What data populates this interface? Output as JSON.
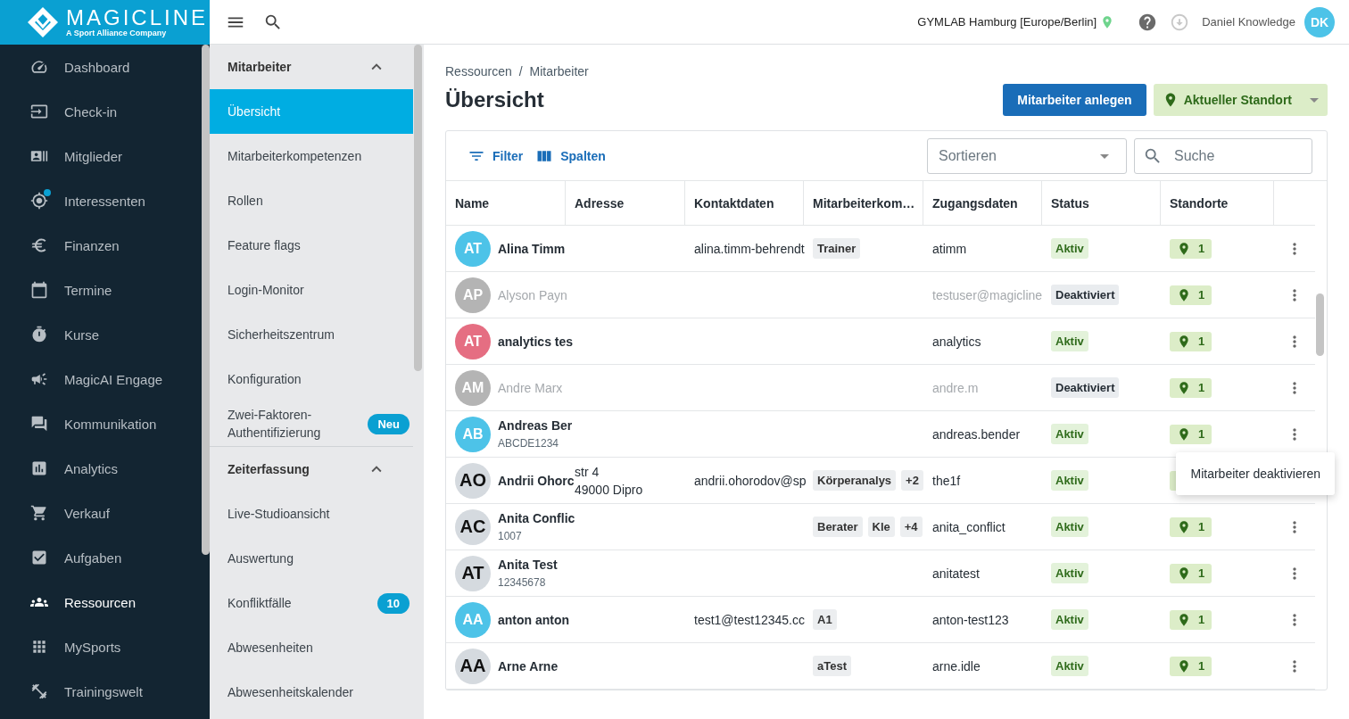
{
  "logo": {
    "name": "MAGICLINE",
    "tagline": "A Sport Alliance Company"
  },
  "nav": [
    {
      "label": "Dashboard",
      "selected": false,
      "dot": false
    },
    {
      "label": "Check-in",
      "selected": false,
      "dot": false
    },
    {
      "label": "Mitglieder",
      "selected": false,
      "dot": false
    },
    {
      "label": "Interessenten",
      "selected": false,
      "dot": true
    },
    {
      "label": "Finanzen",
      "selected": false,
      "dot": false
    },
    {
      "label": "Termine",
      "selected": false,
      "dot": false
    },
    {
      "label": "Kurse",
      "selected": false,
      "dot": false
    },
    {
      "label": "MagicAI Engage",
      "selected": false,
      "dot": false
    },
    {
      "label": "Kommunikation",
      "selected": false,
      "dot": false
    },
    {
      "label": "Analytics",
      "selected": false,
      "dot": false
    },
    {
      "label": "Verkauf",
      "selected": false,
      "dot": false
    },
    {
      "label": "Aufgaben",
      "selected": false,
      "dot": false
    },
    {
      "label": "Ressourcen",
      "selected": true,
      "dot": false
    },
    {
      "label": "MySports",
      "selected": false,
      "dot": false
    },
    {
      "label": "Trainingswelt",
      "selected": false,
      "dot": false
    }
  ],
  "subnav": [
    {
      "title": "Mitarbeiter",
      "expanded": true,
      "items": [
        {
          "label": "Übersicht",
          "selected": true
        },
        {
          "label": "Mitarbeiterkompetenzen",
          "selected": false
        },
        {
          "label": "Rollen",
          "selected": false
        },
        {
          "label": "Feature flags",
          "selected": false
        },
        {
          "label": "Login-Monitor",
          "selected": false
        },
        {
          "label": "Sicherheitszentrum",
          "selected": false
        },
        {
          "label": "Konfiguration",
          "selected": false
        },
        {
          "label": "Zwei-Faktoren-Authentifizierung",
          "selected": false,
          "badge": "Neu"
        }
      ]
    },
    {
      "title": "Zeiterfassung",
      "expanded": true,
      "items": [
        {
          "label": "Live-Studioansicht",
          "selected": false
        },
        {
          "label": "Auswertung",
          "selected": false
        },
        {
          "label": "Konfliktfälle",
          "selected": false,
          "badge": "10"
        },
        {
          "label": "Abwesenheiten",
          "selected": false
        },
        {
          "label": "Abwesenheitskalender",
          "selected": false
        }
      ]
    }
  ],
  "topbar": {
    "location": "GYMLAB Hamburg [Europe/Berlin]",
    "user": "Daniel Knowledge",
    "initials": "DK"
  },
  "breadcrumb": [
    "Ressourcen",
    "Mitarbeiter"
  ],
  "breadcrumb_separator": "/",
  "title": "Übersicht",
  "buttons": {
    "create": "Mitarbeiter anlegen",
    "location": "Aktueller Standort"
  },
  "toolbar": {
    "filter": "Filter",
    "columns": "Spalten",
    "sort": {
      "placeholder": "Sortieren"
    },
    "search": {
      "placeholder": "Suche"
    }
  },
  "table": {
    "columns": [
      "Name",
      "Adresse",
      "Kontaktdaten",
      "Mitarbeiterkom…",
      "Zugangsdaten",
      "Status",
      "Standorte"
    ],
    "rows": [
      {
        "initials": "AT",
        "color": "#4dc3e8",
        "name": "Alina Timm",
        "id": "",
        "address": [],
        "contact": "alina.timm-behrendt",
        "tags": [
          "Trainer"
        ],
        "more": "",
        "login": "atimm",
        "status": "Aktiv",
        "active": true,
        "sites": "1"
      },
      {
        "initials": "AP",
        "color": "#b4b4b4",
        "name": "Alyson Payn",
        "id": "",
        "address": [],
        "contact": "",
        "tags": [],
        "more": "",
        "login": "testuser@magicline",
        "status": "Deaktiviert",
        "active": false,
        "sites": "1"
      },
      {
        "initials": "AT",
        "color": "#e56e82",
        "name": "analytics tes",
        "id": "",
        "address": [],
        "contact": "",
        "tags": [],
        "more": "",
        "login": "analytics",
        "status": "Aktiv",
        "active": true,
        "sites": "1"
      },
      {
        "initials": "AM",
        "color": "#b4b4b4",
        "name": "Andre Marx",
        "id": "",
        "address": [],
        "contact": "",
        "tags": [],
        "more": "",
        "login": "andre.m",
        "status": "Deaktiviert",
        "active": false,
        "sites": "1"
      },
      {
        "initials": "AB",
        "color": "#4dc3e8",
        "name": "Andreas Ber",
        "id": "ABCDE1234",
        "address": [],
        "contact": "",
        "tags": [],
        "more": "",
        "login": "andreas.bender",
        "status": "Aktiv",
        "active": true,
        "sites": "1",
        "menu": [
          "Mitarbeiter deaktivieren"
        ]
      },
      {
        "initials": "AO",
        "color": "#d5dadf",
        "name": "Andrii Ohorc",
        "id": "",
        "address": [
          "str 4",
          "49000 Dipro"
        ],
        "contact": "andrii.ohorodov@sp",
        "tags": [
          "Körperanalys"
        ],
        "more": "+2",
        "login": "the1f",
        "status": "Aktiv",
        "active": true
      },
      {
        "initials": "AC",
        "color": "#d5dadf",
        "name": "Anita Conflic",
        "id": "1007",
        "address": [],
        "contact": "",
        "tags": [
          "Berater",
          "Kle"
        ],
        "more": "+4",
        "login": "anita_conflict",
        "status": "Aktiv",
        "active": true,
        "sites": "1"
      },
      {
        "initials": "AT",
        "color": "#d5dadf",
        "name": "Anita Test",
        "id": "12345678",
        "address": [],
        "contact": "",
        "tags": [],
        "more": "",
        "login": "anitatest",
        "status": "Aktiv",
        "active": true,
        "sites": "1"
      },
      {
        "initials": "AA",
        "color": "#4dc3e8",
        "name": "anton anton",
        "id": "",
        "address": [],
        "contact": "test1@test12345.cc",
        "tags": [
          "A1"
        ],
        "more": "",
        "login": "anton-test123",
        "status": "Aktiv",
        "active": true,
        "sites": "1"
      },
      {
        "initials": "AA",
        "color": "#d5dadf",
        "name": "Arne Arne",
        "id": "",
        "address": [],
        "contact": "",
        "tags": [
          "aTest"
        ],
        "more": "",
        "login": "arne.idle",
        "status": "Aktiv",
        "active": true,
        "sites": "1"
      }
    ]
  }
}
